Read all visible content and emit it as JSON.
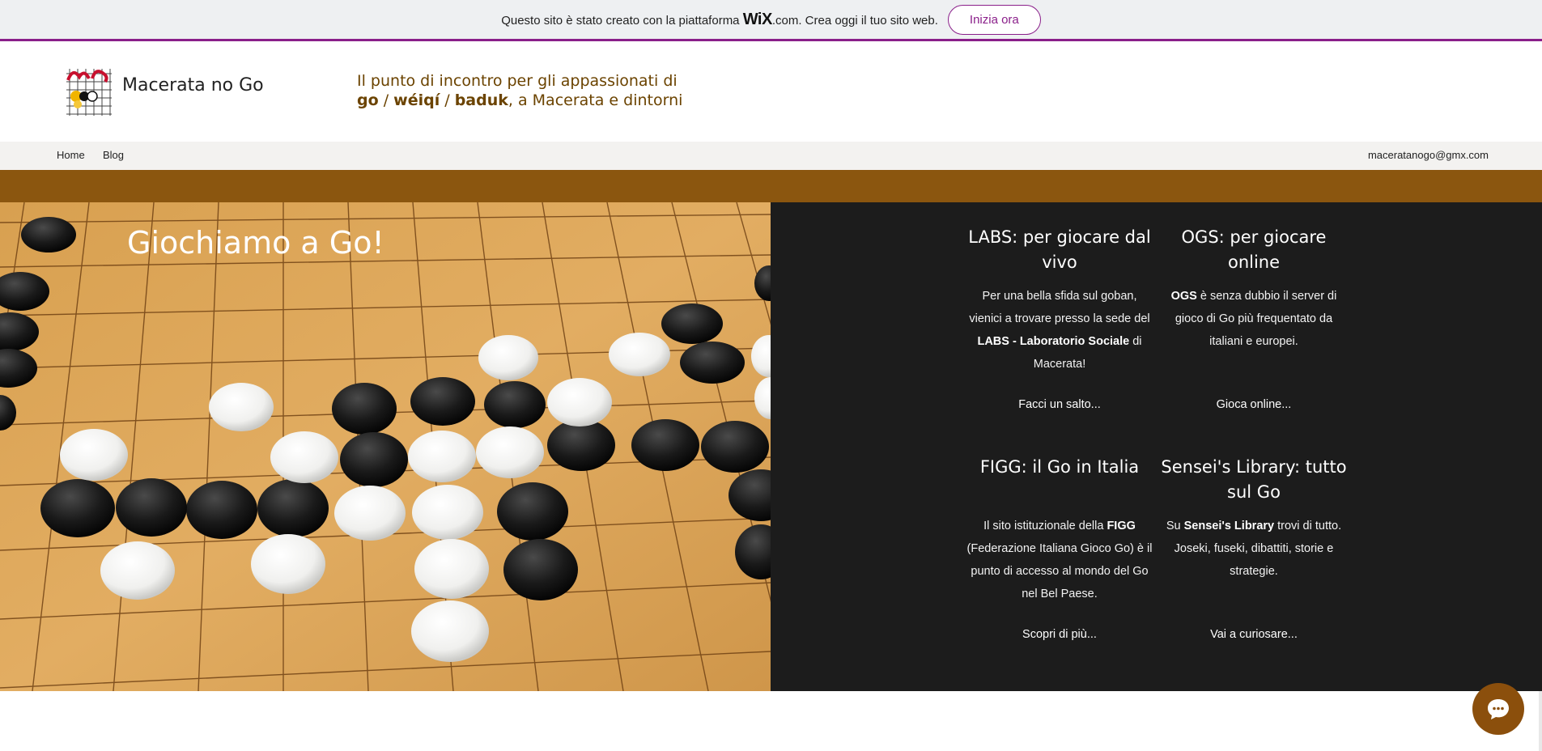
{
  "wix_bar": {
    "message_before": "Questo sito è stato creato con la piattaforma",
    "brand": "WiX",
    "message_after": ".com. Crea oggi il tuo sito web.",
    "cta_label": "Inizia ora"
  },
  "header": {
    "site_name": "Macerata no Go",
    "tagline_line1": "Il punto di incontro per gli appassionati di",
    "tagline_go": "go",
    "tagline_sep1": " / ",
    "tagline_weiqi": "wéiqí",
    "tagline_sep2": " / ",
    "tagline_baduk": "baduk",
    "tagline_rest": ", a Macerata e dintorni"
  },
  "nav": {
    "items": [
      {
        "label": "Home"
      },
      {
        "label": "Blog"
      }
    ],
    "email": "maceratanogo@gmx.com"
  },
  "hero": {
    "title": "Giochiamo a Go!"
  },
  "cards": [
    {
      "title": "LABS: per giocare dal vivo",
      "text_1": "Per una bella sfida sul goban, vienici a trovare presso la sede del ",
      "text_bold": "LABS - Laboratorio Sociale",
      "text_2": " di Macerata!",
      "link": "Facci un salto..."
    },
    {
      "title": "OGS: per giocare online",
      "text_bold": "OGS",
      "text_2": " è senza dubbio il server di gioco di Go più frequentato da italiani e europei.",
      "link": "Gioca online..."
    },
    {
      "title": "FIGG: il Go in Italia",
      "text_1": "Il sito istituzionale della ",
      "text_bold": "FIGG",
      "text_2": " (Federazione Italiana Gioco Go) è il punto di accesso al mondo del Go nel Bel Paese.",
      "link": "Scopri di più..."
    },
    {
      "title": "Sensei's Library: tutto sul Go",
      "text_1": "Su ",
      "text_bold": "Sensei's Library",
      "text_2": " trovi di tutto. Joseki, fuseki, dibattiti, storie e strategie.",
      "link": "Vai a curiosare..."
    }
  ],
  "icons": {
    "chat": "chat-bubble-icon",
    "logo": "go-board-logo"
  },
  "colors": {
    "accent_purple": "#8a1f8a",
    "brown": "#8b560f",
    "dark_panel": "#1c1c1c",
    "tagline": "#6b4300"
  }
}
